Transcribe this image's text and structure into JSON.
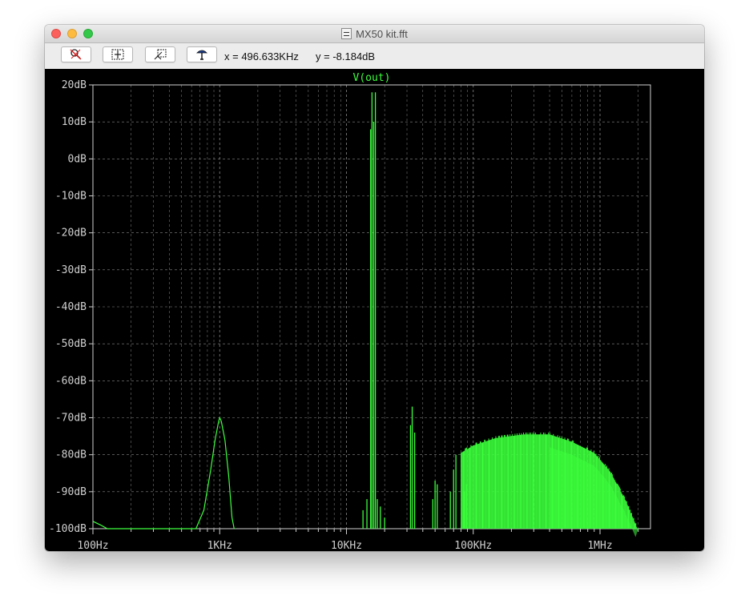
{
  "window": {
    "title": "MX50 kit.fft"
  },
  "toolbar": {
    "buttons": [
      {
        "name": "zoom-cancel-button",
        "icon": "zoom-cancel-icon"
      },
      {
        "name": "zoom-extents-button",
        "icon": "zoom-extents-icon"
      },
      {
        "name": "zoom-back-button",
        "icon": "zoom-back-icon"
      },
      {
        "name": "pan-button",
        "icon": "pan-hand-icon"
      }
    ],
    "cursor_x": "x = 496.633KHz",
    "cursor_y": "y = -8.184dB"
  },
  "colors": {
    "background": "#000000",
    "trace": "#3cff3c",
    "grid": "#8a8a8a",
    "labels": "#cfcfcf",
    "title": "#3cff3c"
  },
  "chart_data": {
    "type": "line",
    "title": "V(out)",
    "xscale": "log",
    "xlim": [
      100,
      2500000
    ],
    "ylim": [
      -100,
      20
    ],
    "grid": true,
    "x_ticks": [
      {
        "value": 100,
        "label": "100Hz"
      },
      {
        "value": 1000,
        "label": "1KHz"
      },
      {
        "value": 10000,
        "label": "10KHz"
      },
      {
        "value": 100000,
        "label": "100KHz"
      },
      {
        "value": 1000000,
        "label": "1MHz"
      }
    ],
    "y_ticks": [
      {
        "value": 20,
        "label": "20dB"
      },
      {
        "value": 10,
        "label": "10dB"
      },
      {
        "value": 0,
        "label": "0dB"
      },
      {
        "value": -10,
        "label": "-10dB"
      },
      {
        "value": -20,
        "label": "-20dB"
      },
      {
        "value": -30,
        "label": "-30dB"
      },
      {
        "value": -40,
        "label": "-40dB"
      },
      {
        "value": -50,
        "label": "-50dB"
      },
      {
        "value": -60,
        "label": "-60dB"
      },
      {
        "value": -70,
        "label": "-70dB"
      },
      {
        "value": -80,
        "label": "-80dB"
      },
      {
        "value": -90,
        "label": "-90dB"
      },
      {
        "value": -100,
        "label": "-100dB"
      }
    ],
    "series": [
      {
        "name": "V(out)",
        "x": [
          100,
          115,
          130,
          650,
          750,
          850,
          920,
          980,
          1000,
          1030,
          1100,
          1180,
          1250,
          1300
        ],
        "y": [
          -98,
          -99,
          -100,
          -100,
          -95,
          -84,
          -76,
          -71,
          -70,
          -71,
          -76,
          -86,
          -97,
          -100
        ]
      }
    ],
    "spikes": [
      {
        "x": 12000,
        "y": -100
      },
      {
        "x": 13500,
        "y": -95
      },
      {
        "x": 14500,
        "y": -92
      },
      {
        "x": 15500,
        "y": 8
      },
      {
        "x": 15900,
        "y": 18
      },
      {
        "x": 16400,
        "y": 10
      },
      {
        "x": 16900,
        "y": 18
      },
      {
        "x": 17500,
        "y": -92
      },
      {
        "x": 18500,
        "y": -94
      },
      {
        "x": 20000,
        "y": -97
      },
      {
        "x": 32000,
        "y": -72
      },
      {
        "x": 33000,
        "y": -67
      },
      {
        "x": 34500,
        "y": -74
      },
      {
        "x": 48000,
        "y": -92
      },
      {
        "x": 50000,
        "y": -87
      },
      {
        "x": 52000,
        "y": -88
      },
      {
        "x": 66000,
        "y": -90
      },
      {
        "x": 70000,
        "y": -84
      },
      {
        "x": 73000,
        "y": -80
      },
      {
        "x": 85000,
        "y": -90
      },
      {
        "x": 88000,
        "y": -88
      }
    ],
    "envelope": {
      "x": [
        80000,
        100000,
        150000,
        250000,
        400000,
        600000,
        900000,
        1200000,
        1600000,
        2000000
      ],
      "y": [
        -79,
        -77,
        -75,
        -74,
        -74,
        -76,
        -79,
        -84,
        -92,
        -100
      ]
    }
  }
}
